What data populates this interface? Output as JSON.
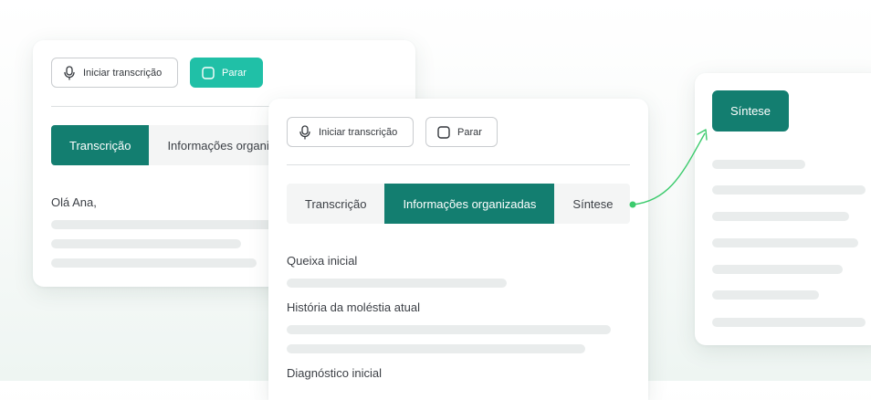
{
  "card_back": {
    "start_label": "Iniciar transcrição",
    "stop_label": "Parar",
    "tabs": [
      "Transcrição",
      "Informações organi"
    ],
    "greeting": "Olá Ana,"
  },
  "card_front": {
    "start_label": "Iniciar transcrição",
    "stop_label": "Parar",
    "tabs": [
      "Transcrição",
      "Informações organizadas",
      "Síntese"
    ],
    "sections": [
      "Queixa inicial",
      "História da moléstia atual",
      "Diagnóstico inicial"
    ]
  },
  "card_synthesis": {
    "title": "Síntese"
  },
  "colors": {
    "accent_dark": "#137e70",
    "accent_light": "#20c0a7",
    "connector": "#3ccb6d"
  }
}
